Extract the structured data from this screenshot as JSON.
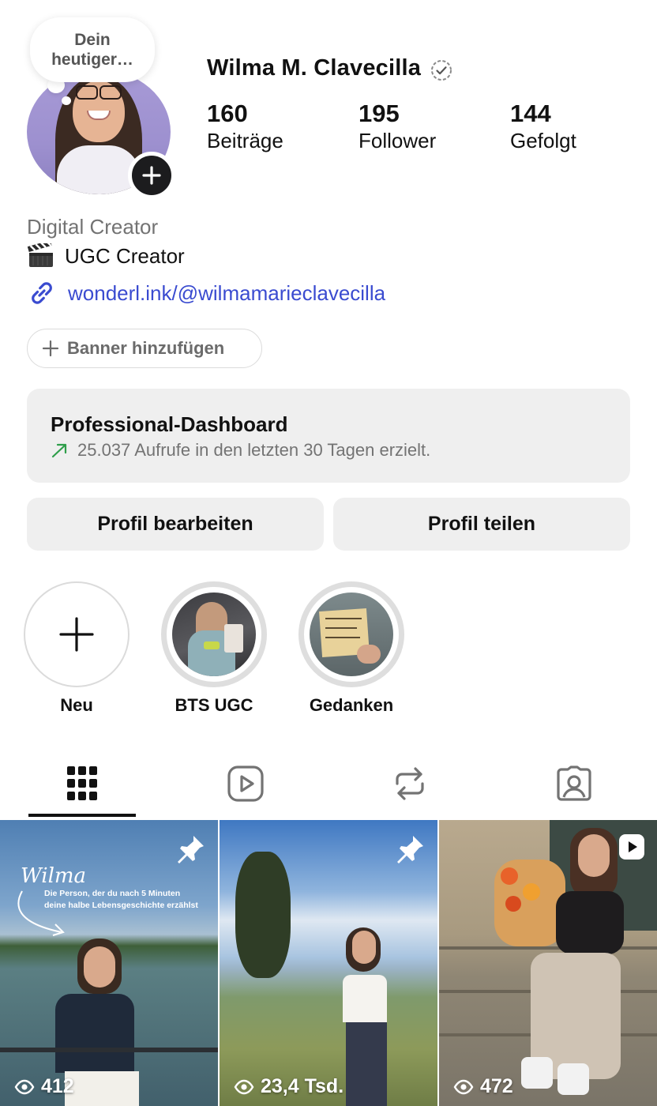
{
  "profile": {
    "thought_bubble": "Dein heutiger…",
    "username": "Wilma M. Clavecilla",
    "stats": [
      {
        "value": "160",
        "label": "Beiträge"
      },
      {
        "value": "195",
        "label": "Follower"
      },
      {
        "value": "144",
        "label": "Gefolgt"
      }
    ],
    "category": "Digital Creator",
    "bio": "UGC Creator",
    "link": "wonderl.ink/@wilmamarieclavecilla",
    "banner_button": "Banner hinzufügen"
  },
  "dashboard": {
    "title": "Professional-Dashboard",
    "subtitle": "25.037 Aufrufe in den letzten 30 Tagen erzielt."
  },
  "actions": {
    "edit_profile": "Profil bearbeiten",
    "share_profile": "Profil teilen"
  },
  "highlights": [
    {
      "label": "Neu"
    },
    {
      "label": "BTS UGC"
    },
    {
      "label": "Gedanken"
    }
  ],
  "tabs": [
    "grid-icon",
    "reels-icon",
    "reposts-icon",
    "tagged-icon"
  ],
  "grid": [
    {
      "views": "412",
      "overlay_title": "Wilma",
      "overlay_caption": "Die Person, der du nach 5 Minuten deine halbe Lebensgeschichte erzählst",
      "pinned": true
    },
    {
      "views": "23,4 Tsd.",
      "pinned": true
    },
    {
      "views": "472",
      "reel": true
    }
  ],
  "colors": {
    "link": "#3a4bd0",
    "muted": "#737373",
    "button_bg": "#efefef",
    "trend_green": "#2e9e4a"
  }
}
